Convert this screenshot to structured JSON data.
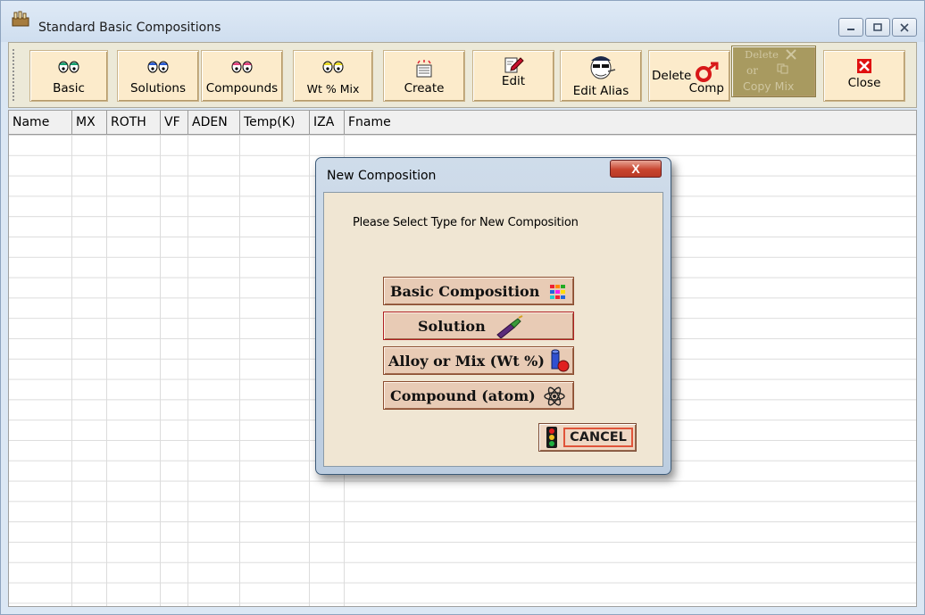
{
  "window": {
    "title": "Standard Basic Compositions"
  },
  "toolbar": {
    "basic": "Basic",
    "solutions": "Solutions",
    "compounds": "Compounds",
    "wt_mix": "Wt % Mix",
    "create": "Create",
    "edit": "Edit",
    "edit_alias": "Edit Alias",
    "delete_comp_line1": "Delete",
    "delete_comp_line2": "Comp",
    "delete_copy_line1": "Delete",
    "delete_copy_line2": "or",
    "delete_copy_line3": "Copy Mix",
    "close": "Close"
  },
  "grid": {
    "columns": [
      "Name",
      "MX",
      "ROTH",
      "VF",
      "ADEN",
      "Temp(K)",
      "IZA",
      "Fname"
    ]
  },
  "dialog": {
    "title": "New Composition",
    "close_glyph": "X",
    "prompt": "Please Select Type for New Composition",
    "basic_composition": "Basic Composition",
    "solution": "Solution",
    "alloy_mix": "Alloy or Mix (Wt %)",
    "compound": "Compound (atom)",
    "cancel": "CANCEL"
  },
  "colors": {
    "toolbar_button": "#fcebcb",
    "choice_button": "#e8cbb5",
    "dialog_client": "#f0e6d3",
    "close_red": "#c8452f"
  }
}
